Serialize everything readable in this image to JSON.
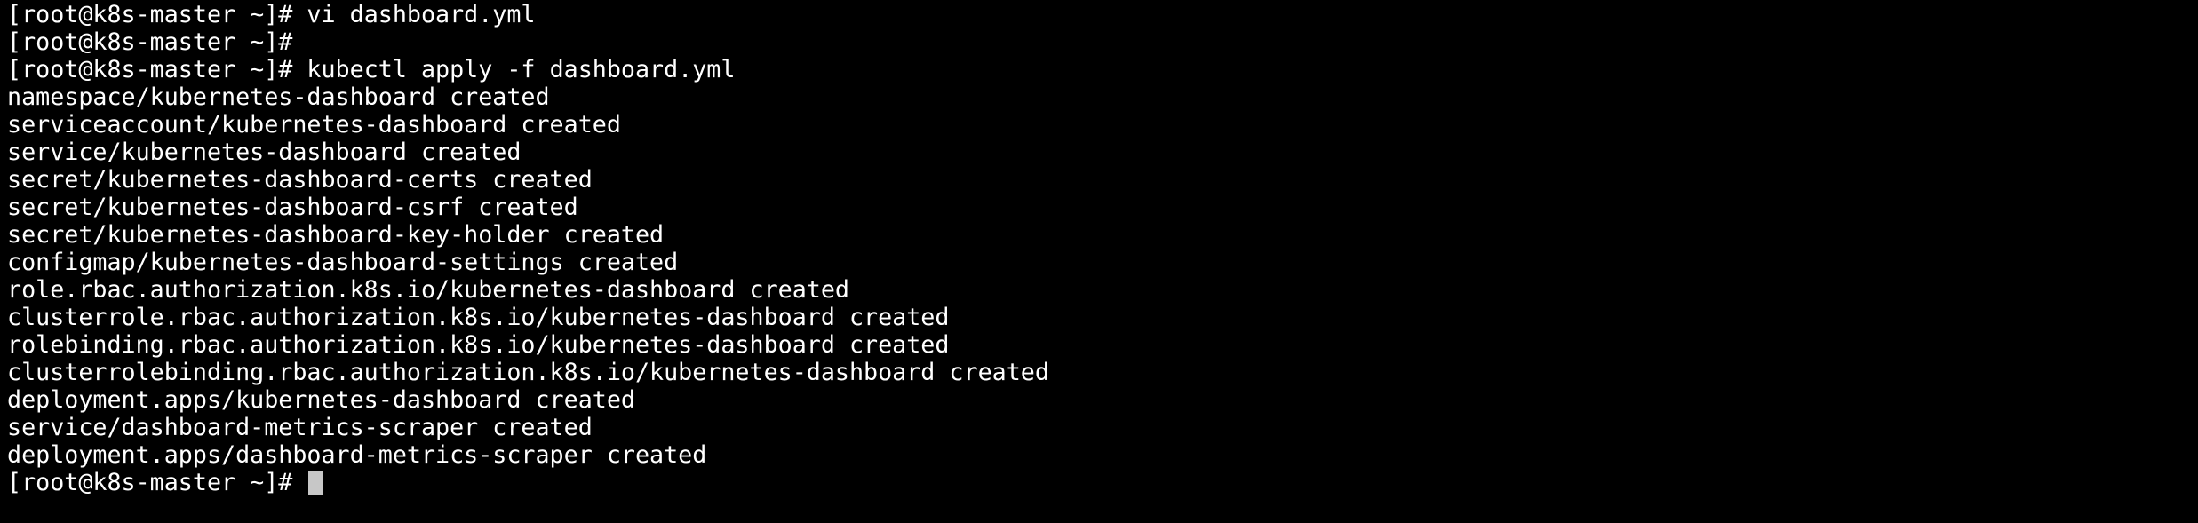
{
  "terminal": {
    "prompt": "[root@k8s-master ~]# ",
    "lines": [
      {
        "prompt": "[root@k8s-master ~]# ",
        "command": "vi dashboard.yml"
      },
      {
        "prompt": "[root@k8s-master ~]# ",
        "command": ""
      },
      {
        "prompt": "[root@k8s-master ~]# ",
        "command": "kubectl apply -f dashboard.yml"
      },
      {
        "output": "namespace/kubernetes-dashboard created"
      },
      {
        "output": "serviceaccount/kubernetes-dashboard created"
      },
      {
        "output": "service/kubernetes-dashboard created"
      },
      {
        "output": "secret/kubernetes-dashboard-certs created"
      },
      {
        "output": "secret/kubernetes-dashboard-csrf created"
      },
      {
        "output": "secret/kubernetes-dashboard-key-holder created"
      },
      {
        "output": "configmap/kubernetes-dashboard-settings created"
      },
      {
        "output": "role.rbac.authorization.k8s.io/kubernetes-dashboard created"
      },
      {
        "output": "clusterrole.rbac.authorization.k8s.io/kubernetes-dashboard created"
      },
      {
        "output": "rolebinding.rbac.authorization.k8s.io/kubernetes-dashboard created"
      },
      {
        "output": "clusterrolebinding.rbac.authorization.k8s.io/kubernetes-dashboard created"
      },
      {
        "output": "deployment.apps/kubernetes-dashboard created"
      },
      {
        "output": "service/dashboard-metrics-scraper created"
      },
      {
        "output": "deployment.apps/dashboard-metrics-scraper created"
      }
    ],
    "current_prompt": "[root@k8s-master ~]# ",
    "colors": {
      "background": "#000000",
      "foreground": "#ffffff",
      "cursor": "#c7c7c7"
    }
  }
}
